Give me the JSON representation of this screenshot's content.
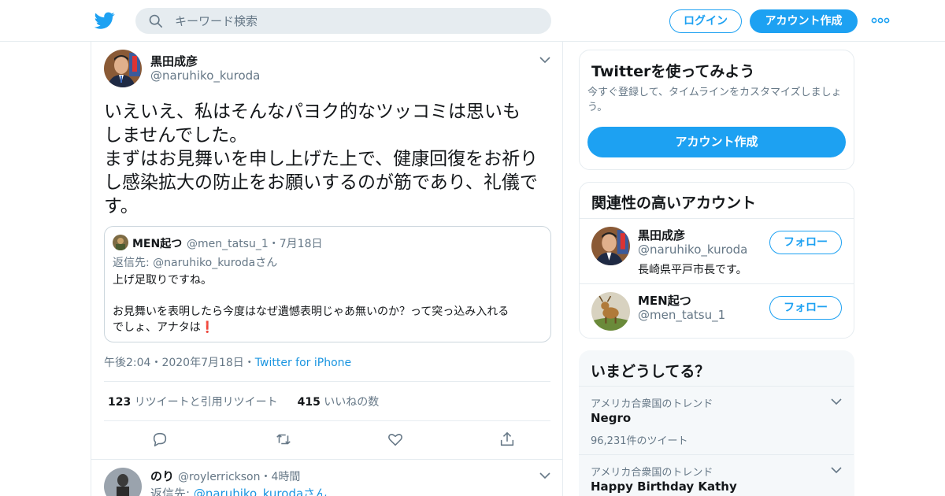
{
  "header": {
    "search_placeholder": "キーワード検索",
    "login_label": "ログイン",
    "signup_label": "アカウント作成",
    "accent_color": "#1da1f2"
  },
  "tweet": {
    "name": "黒田成彦",
    "handle": "@naruhiko_kuroda",
    "text": "いえいえ、私はそんなパヨク的なツッコミは思いも\nしませんでした。\nまずはお見舞いを申し上げた上で、健康回復をお祈り\nし感染拡大の防止をお願いするのが筋であり、礼儀で\nす。",
    "quote": {
      "name": "MEN起つ",
      "handle": "@men_tatsu_1・7月18日",
      "reply_prefix": "返信先: ",
      "reply_to": "@naruhiko_kurodaさん",
      "body": "上げ足取りですね。\n\nお見舞いを表明したら今度はなぜ遺憾表明じゃあ無いのか？って突っ込み入れる\nでしょ、アナタは❗️"
    },
    "time": "午後2:04・2020年7月18日・",
    "source": "Twitter for iPhone",
    "retweet_count": "123",
    "retweet_label": "リツイートと引用リツイート",
    "like_count": "415",
    "like_label": "いいねの数",
    "actions": [
      "reply-icon",
      "retweet-icon",
      "like-icon",
      "share-icon"
    ]
  },
  "reply": {
    "name": "のり",
    "handle": "@roylerrickson・4時間",
    "reply_prefix": "返信先: ",
    "reply_to": "@naruhiko_kurodaさん"
  },
  "sidebar": {
    "signup_card": {
      "title": "Twitterを使ってみよう",
      "description": "今すぐ登録して、タイムラインをカスタマイズしましょう。",
      "button": "アカウント作成"
    },
    "related": {
      "title": "関連性の高いアカウント",
      "accounts": [
        {
          "name": "黒田成彦",
          "handle": "@naruhiko_kuroda",
          "bio": "長崎県平戸市長です。",
          "follow": "フォロー"
        },
        {
          "name": "MEN起つ",
          "handle": "@men_tatsu_1",
          "bio": "",
          "follow": "フォロー"
        }
      ]
    },
    "trends": {
      "title": "いまどうしてる？",
      "items": [
        {
          "location": "アメリカ合衆国のトレンド",
          "name": "Negro",
          "count": "96,231件のツイート"
        },
        {
          "location": "アメリカ合衆国のトレンド",
          "name": "Happy Birthday Kathy",
          "count": ""
        }
      ]
    }
  }
}
